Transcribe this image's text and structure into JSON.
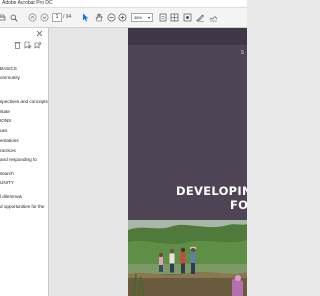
{
  "window": {
    "title": "Adobe Acrobat Pro DC"
  },
  "toolbar": {
    "current_page": "1",
    "total_pages": "/ 94",
    "zoom": "38%",
    "icons": [
      "print-icon",
      "search-icon",
      "page-up-icon",
      "page-down-icon",
      "select-cursor-icon",
      "hand-icon",
      "zoom-out-icon",
      "zoom-in-icon",
      "zoom-caret-icon",
      "fit-page-icon",
      "scroll-mode-icon",
      "comment-icon",
      "highlight-icon",
      "sign-icon"
    ]
  },
  "sidebar": {
    "icons": [
      "close-icon",
      "delete-bookmark-icon",
      "new-bookmark-icon",
      "expand-bookmark-icon"
    ],
    "bookmarks": [
      "BASICS",
      "ommunity",
      "",
      "spectives and concepts",
      "state",
      "IONS",
      "ues",
      "entations",
      "ractices",
      "and responding to",
      "search",
      "UNITY",
      "",
      "l dilemmas",
      "d opportunities for the"
    ]
  },
  "document": {
    "cover_line1": "DEVELOPING C",
    "cover_line2": "FOR",
    "cover_corner": "S"
  },
  "colors": {
    "cover_top": "#3f3647",
    "cover_main": "#4f4456",
    "toolbar_bg": "#f4f4f4",
    "workspace_bg": "#e6e6e6"
  }
}
